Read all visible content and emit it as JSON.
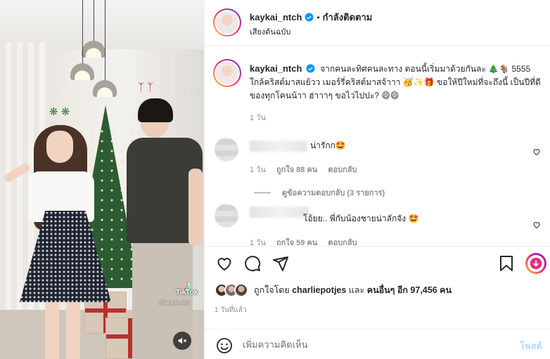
{
  "post": {
    "username": "kaykai_ntch",
    "separator": "•",
    "follow_label": "กำลังติดตาม",
    "audio": "เสียงต้นฉบับ",
    "caption": "จากคนละทิศคนละทาง ตอนนี้เริ่มมาด้วยกันละ 🎄🐐 5555 ใกล้คริสต์มาสแย้วว เมอร์รี่คริสต์มาสจ้าาา 🥳✨🎁 ขอให้ปีใหม่ที่จะถึงนี้ เป็นปีที่ดีของทุกโคนน้าา ฮ่าาาๆ ขอไวไปปะ? 😄😄",
    "caption_time": "1 วัน"
  },
  "video": {
    "tiktok_logo": "♪",
    "tiktok_word": "TikTok",
    "tiktok_handle": "@kaykai_ntch"
  },
  "comments": [
    {
      "text": "น่ารักก🤩",
      "time": "1 วัน",
      "likes": "ถูกใจ 88 คน",
      "reply": "ตอบกลับ",
      "view_replies": "ดูข้อความตอบกลับ (3 รายการ)"
    },
    {
      "text": "โอ้ยย.. พี่กับน้องชายน่าลักจัง 🤩",
      "time": "1 วัน",
      "likes": "ถูกใจ 59 คน",
      "reply": "ตอบกลับ"
    }
  ],
  "engagement": {
    "liked_by_prefix": "ถูกใจโดย ",
    "liked_by_user": "charliepotjes",
    "liked_by_middle": " และ ",
    "liked_by_others": "คนอื่นๆ อีก 97,456 คน",
    "posted_ago": "1 วันที่แล้ว"
  },
  "composer": {
    "placeholder": "เพิ่มความคิดเห็น",
    "post_label": "โพสต์"
  },
  "colors": {
    "verified": "#0095f6",
    "post_disabled": "#b3dbff",
    "reels_badge": "#ee2a7b"
  }
}
